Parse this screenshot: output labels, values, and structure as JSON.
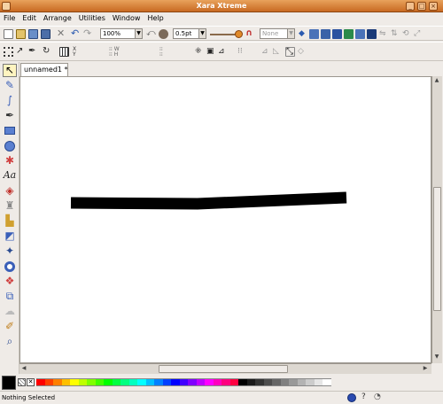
{
  "window": {
    "title": "Xara Xtreme",
    "minimize_icon": "minimize-icon",
    "maximize_icon": "maximize-icon",
    "close_icon": "close-icon"
  },
  "menu": [
    "File",
    "Edit",
    "Arrange",
    "Utilities",
    "Window",
    "Help"
  ],
  "toolbar": {
    "zoom_value": "100%",
    "line_width_value": "0.5pt",
    "arrowhead_value": "None"
  },
  "document": {
    "tab_label": "unnamed1 *"
  },
  "status": {
    "text": "Nothing Selected"
  },
  "colors": {
    "current": "#000000",
    "palette": [
      "#ff0000",
      "#ff4000",
      "#ff7f00",
      "#ffbf00",
      "#ffff00",
      "#bfff00",
      "#80ff00",
      "#40ff00",
      "#00ff00",
      "#00ff40",
      "#00ff80",
      "#00ffbf",
      "#00ffff",
      "#00bfff",
      "#0080ff",
      "#0040ff",
      "#0000ff",
      "#4000ff",
      "#8000ff",
      "#bf00ff",
      "#ff00ff",
      "#ff00bf",
      "#ff0080",
      "#ff0040",
      "#000000",
      "#1a1a1a",
      "#333333",
      "#4d4d4d",
      "#666666",
      "#808080",
      "#999999",
      "#b3b3b3",
      "#cccccc",
      "#e6e6e6",
      "#ffffff"
    ]
  },
  "left_tools": [
    "selector-tool-icon",
    "shape-editor-tool-icon",
    "freehand-tool-icon",
    "pen-tool-icon",
    "rectangle-tool-icon",
    "ellipse-tool-icon",
    "quickshape-tool-icon",
    "text-tool-icon",
    "fill-tool-icon",
    "transparency-tool-icon",
    "shadow-tool-icon",
    "bevel-tool-icon",
    "contour-tool-icon",
    "blend-tool-icon",
    "mould-tool-icon",
    "live-effects-tool-icon",
    "push-tool-icon",
    "zoom-tool-icon"
  ]
}
